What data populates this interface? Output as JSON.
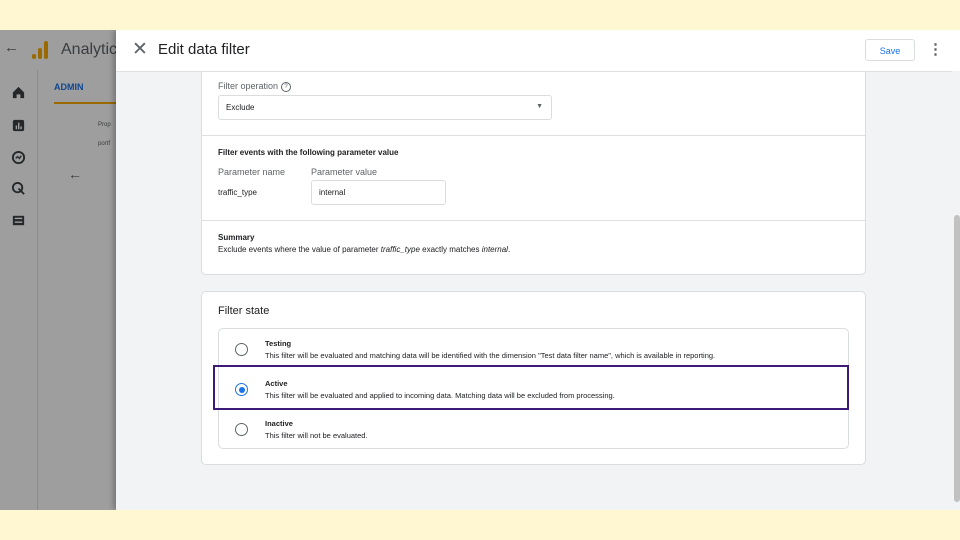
{
  "background_app": {
    "title": "Analytics",
    "admin_tab": "ADMIN",
    "property_label": "Prop",
    "property_value": "portf"
  },
  "panel": {
    "title": "Edit data filter",
    "save_label": "Save"
  },
  "filter_operation": {
    "label": "Filter operation",
    "value": "Exclude"
  },
  "parameter": {
    "heading": "Filter events with the following parameter value",
    "name_header": "Parameter name",
    "value_header": "Parameter value",
    "name": "traffic_type",
    "value": "internal"
  },
  "summary": {
    "heading": "Summary",
    "prefix": "Exclude events where the value of parameter ",
    "param": "traffic_type",
    "middle": " exactly matches ",
    "value": "internal",
    "suffix": "."
  },
  "filter_state": {
    "title": "Filter state",
    "selected": "Active",
    "options": [
      {
        "title": "Testing",
        "description": "This filter will be evaluated and matching data will be identified with the dimension \"Test data filter name\", which is available in reporting."
      },
      {
        "title": "Active",
        "description": "This filter will be evaluated and applied to incoming data. Matching data will be excluded from processing."
      },
      {
        "title": "Inactive",
        "description": "This filter will not be evaluated."
      }
    ]
  },
  "colors": {
    "accent": "#1a73e8",
    "highlight_border": "#3c1a78",
    "frame_background": "#fef7d2",
    "logo": "#f9ab00"
  }
}
